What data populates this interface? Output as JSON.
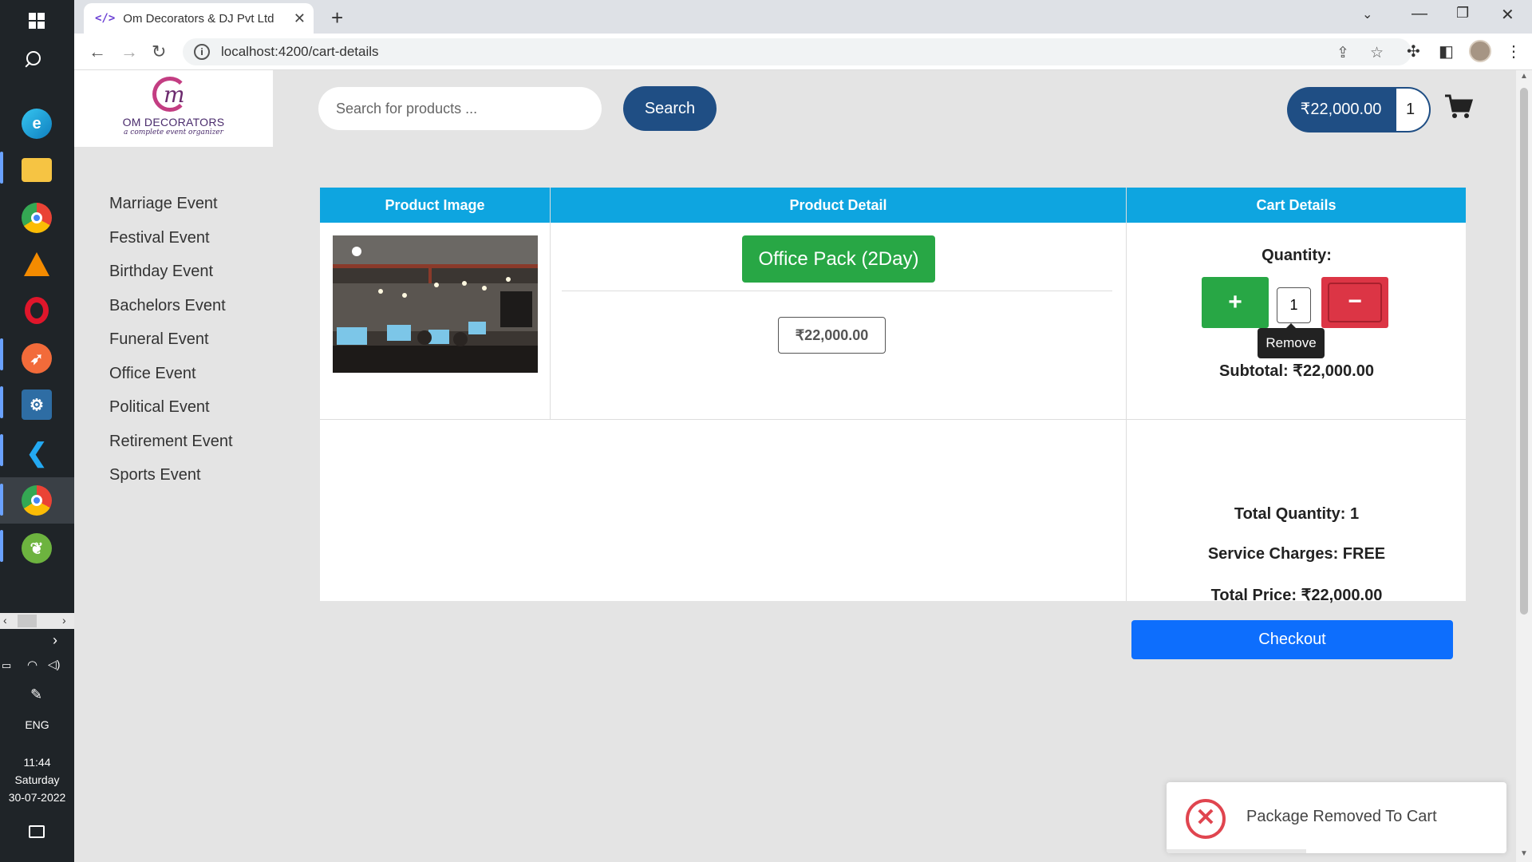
{
  "taskbar": {
    "language": "ENG",
    "time": "11:44",
    "day": "Saturday",
    "date": "30-07-2022"
  },
  "browser": {
    "tab_title": "Om Decorators & DJ Pvt Ltd",
    "tab_favicon": "</>",
    "url": "localhost:4200/cart-details"
  },
  "header": {
    "logo_text": "OM DECORATORS",
    "logo_tagline": "a complete event organizer",
    "search_placeholder": "Search for products ...",
    "search_label": "Search",
    "cart_total": "₹22,000.00",
    "cart_count": "1"
  },
  "sidebar": {
    "items": [
      {
        "label": "Marriage Event"
      },
      {
        "label": "Festival Event"
      },
      {
        "label": "Birthday Event"
      },
      {
        "label": "Bachelors Event"
      },
      {
        "label": "Funeral Event"
      },
      {
        "label": "Office Event"
      },
      {
        "label": "Political Event"
      },
      {
        "label": "Retirement Event"
      },
      {
        "label": "Sports Event"
      }
    ]
  },
  "cart_table": {
    "headers": {
      "image": "Product Image",
      "detail": "Product Detail",
      "cart": "Cart Details"
    },
    "item": {
      "name": "Office Pack (2Day)",
      "price": "₹22,000.00",
      "quantity_label": "Quantity:",
      "quantity": "1",
      "plus_label": "+",
      "minus_label": "−",
      "remove_tooltip": "Remove",
      "subtotal": "Subtotal: ₹22,000.00"
    },
    "summary": {
      "total_quantity": "Total Quantity: 1",
      "service_charges": "Service Charges: FREE",
      "total_price": "Total Price: ₹22,000.00",
      "checkout_label": "Checkout"
    }
  },
  "toast": {
    "message": "Package Removed To Cart"
  },
  "colors": {
    "header_blue": "#1f4e84",
    "table_header": "#0ea5e0",
    "success": "#28a745",
    "danger": "#dc3545",
    "primary": "#0d6efd"
  }
}
